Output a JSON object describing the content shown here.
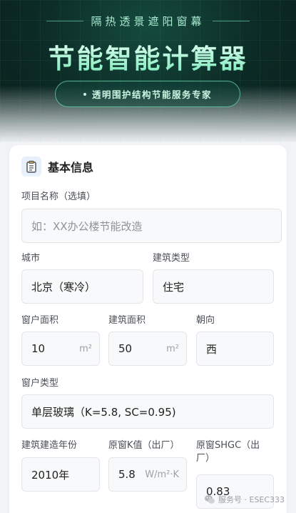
{
  "header": {
    "subtitle": "隔热透景遮阳窗幕",
    "title": "节能智能计算器",
    "badge": "透明围护结构节能服务专家"
  },
  "section": {
    "icon": "clipboard-icon",
    "title": "基本信息"
  },
  "form": {
    "project_name": {
      "label": "项目名称（选填）",
      "placeholder": "如：XX办公楼节能改造"
    },
    "city": {
      "label": "城市",
      "value": "北京（寒冷）"
    },
    "building_type": {
      "label": "建筑类型",
      "value": "住宅"
    },
    "window_area": {
      "label": "窗户面积",
      "value": "10",
      "unit": "m²"
    },
    "building_area": {
      "label": "建筑面积",
      "value": "50",
      "unit": "m²"
    },
    "orientation": {
      "label": "朝向",
      "value": "西"
    },
    "window_type": {
      "label": "窗户类型",
      "value": "单层玻璃（K=5.8, SC=0.95)"
    },
    "build_year": {
      "label": "建筑建造年份",
      "value": "2010年"
    },
    "k_value": {
      "label": "原窗K值（出厂）",
      "value": "5.8",
      "unit": "W/m²·K"
    },
    "shgc": {
      "label_line1": "原窗SHGC（出",
      "label_line2": "厂）",
      "value": "0.83"
    }
  },
  "watermark": {
    "text": "服务号 · ESEC333",
    "icon": "wechat-icon"
  },
  "colors": {
    "accent": "#7ff0c2",
    "hero_bg": "#0c2a25"
  }
}
